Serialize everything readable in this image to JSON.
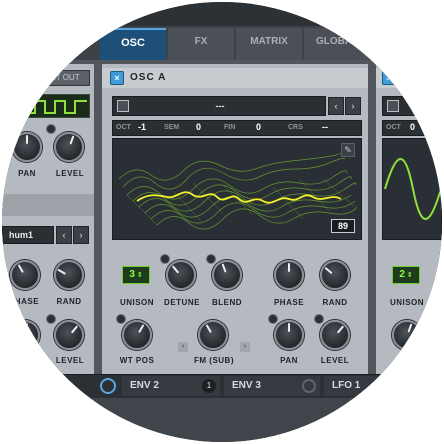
{
  "tabs": {
    "osc": "OSC",
    "fx": "FX",
    "matrix": "MATRIX",
    "global": "GLOBAL"
  },
  "left": {
    "button": "ET OUT",
    "pan": "PAN",
    "level": "LEVEL",
    "preset": "hum1",
    "phase": "PHASE",
    "rand": "RAND",
    "level2": "LEVEL"
  },
  "osc_a": {
    "title": "OSC A",
    "wavetable_name": "---",
    "oct_label": "OCT",
    "oct_value": "-1",
    "sem_label": "SEM",
    "sem_value": "0",
    "fin_label": "FIN",
    "fin_value": "0",
    "crs_label": "CRS",
    "crs_value": "--",
    "frame": "89",
    "unison_value": "3",
    "unison": "UNISON",
    "detune": "DETUNE",
    "blend": "BLEND",
    "phase": "PHASE",
    "rand": "RAND",
    "wt_pos": "WT POS",
    "fm": "FM (SUB)",
    "pan": "PAN",
    "level": "LEVEL"
  },
  "osc_b": {
    "oct_label": "OCT",
    "oct_value": "0",
    "unison_value": "2",
    "unison": "UNISON"
  },
  "bottom": {
    "env2": "ENV 2",
    "env2_num": "1",
    "env3": "ENV 3",
    "lfo1": "LFO 1"
  },
  "colors": {
    "accent_blue": "#5aa6e0",
    "wave_green": "#8fe03a",
    "wave_yellow": "#f2f22a",
    "panel": "#b5bac0"
  }
}
